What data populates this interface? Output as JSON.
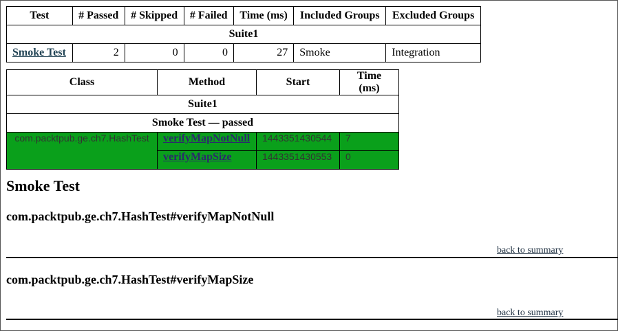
{
  "summary": {
    "headers": [
      "Test",
      "# Passed",
      "# Skipped",
      "# Failed",
      "Time (ms)",
      "Included Groups",
      "Excluded Groups"
    ],
    "suite": "Suite1",
    "row": {
      "test": "Smoke Test",
      "passed": "2",
      "skipped": "0",
      "failed": "0",
      "time": "27",
      "included": "Smoke",
      "excluded": "Integration"
    }
  },
  "methods": {
    "headers": [
      "Class",
      "Method",
      "Start",
      "Time (ms)"
    ],
    "suite": "Suite1",
    "group": "Smoke Test — passed",
    "class_name": "com.packtpub.ge.ch7.HashTest",
    "rows": [
      {
        "method": "verifyMapNotNull",
        "start": "1443351430544",
        "time": "7"
      },
      {
        "method": "verifyMapSize",
        "start": "1443351430553",
        "time": "0"
      }
    ]
  },
  "details": {
    "heading": "Smoke Test",
    "sections": [
      {
        "title": "com.packtpub.ge.ch7.HashTest#verifyMapNotNull",
        "back": "back to summary"
      },
      {
        "title": "com.packtpub.ge.ch7.HashTest#verifyMapSize",
        "back": "back to summary"
      }
    ]
  },
  "colors": {
    "passed": "#0aa01b"
  }
}
